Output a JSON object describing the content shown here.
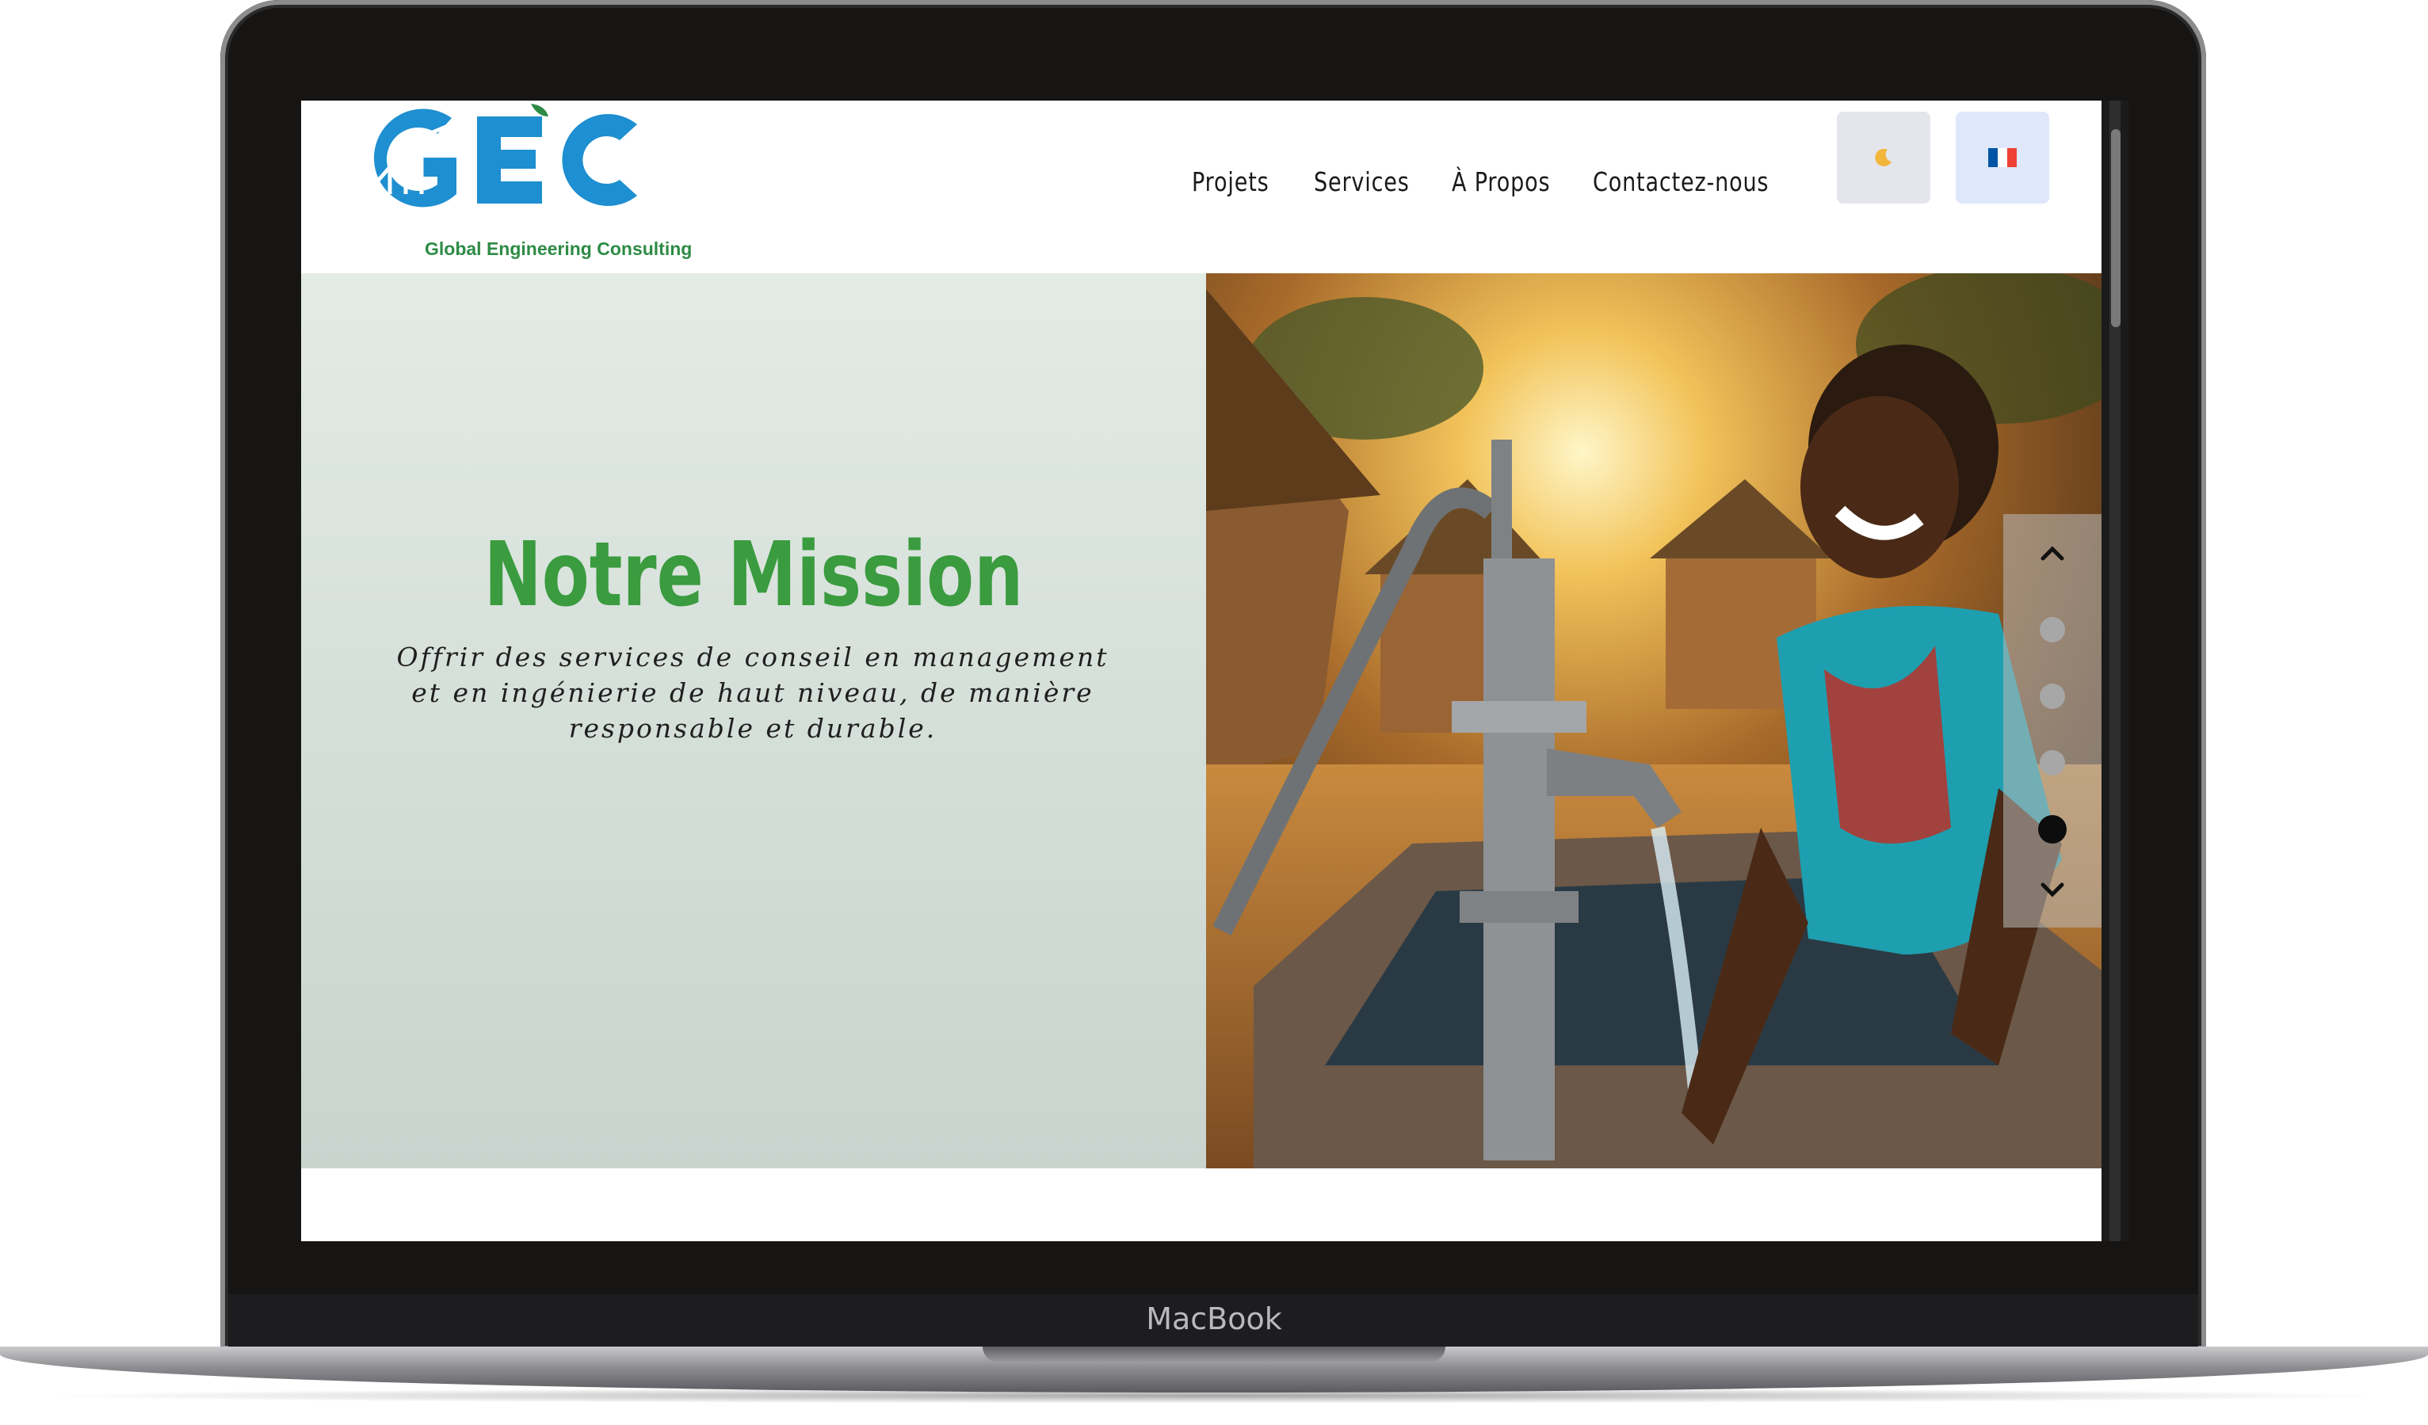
{
  "device": {
    "brand_label": "MacBook"
  },
  "header": {
    "logo_tagline": "Global Engineering Consulting",
    "logo_letters": "GEC",
    "nav": [
      {
        "label": "Projets"
      },
      {
        "label": "Services"
      },
      {
        "label": "À Propos"
      },
      {
        "label": "Contactez-nous"
      }
    ],
    "theme_toggle_icon": "moon-icon",
    "language_flag": "france-flag-icon",
    "flag_colors": [
      "#0055A4",
      "#FFFFFF",
      "#EF4135"
    ]
  },
  "hero": {
    "title": "Notre Mission",
    "text": "Offrir des services de conseil en management et en ingénierie de haut niveau, de manière responsable et durable.",
    "image_description_icon": "photo-girl-at-water-pump",
    "slider": {
      "total": 4,
      "active": 4
    }
  },
  "colors": {
    "title_green": "#3a9b3f",
    "logo_blue": "#1e8fd0",
    "logo_green": "#2e8b45"
  }
}
